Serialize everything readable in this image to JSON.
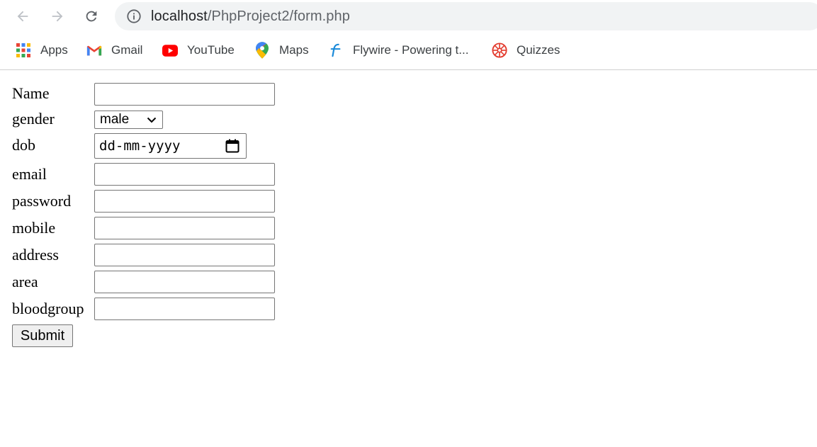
{
  "browser": {
    "url_host": "localhost",
    "url_path": "/PhpProject2/form.php",
    "bookmarks": [
      {
        "label": "Apps",
        "icon": "apps-grid-icon"
      },
      {
        "label": "Gmail",
        "icon": "gmail-icon"
      },
      {
        "label": "YouTube",
        "icon": "youtube-icon"
      },
      {
        "label": "Maps",
        "icon": "maps-pin-icon"
      },
      {
        "label": "Flywire - Powering t...",
        "icon": "flywire-icon"
      },
      {
        "label": "Quizzes",
        "icon": "quizzes-icon"
      }
    ]
  },
  "form": {
    "labels": {
      "name": "Name",
      "gender": "gender",
      "dob": "dob",
      "email": "email",
      "password": "password",
      "mobile": "mobile",
      "address": "address",
      "area": "area",
      "bloodgroup": "bloodgroup"
    },
    "values": {
      "name": "",
      "email": "",
      "password": "",
      "mobile": "",
      "address": "",
      "area": "",
      "bloodgroup": ""
    },
    "gender_selected": "male",
    "dob_placeholder": "dd-mm-yyyy",
    "submit_label": "Submit"
  },
  "colors": {
    "chrome_text": "#3c4043",
    "omnibox_bg": "#f1f3f4",
    "input_border": "#767676",
    "button_bg": "#efefef"
  }
}
